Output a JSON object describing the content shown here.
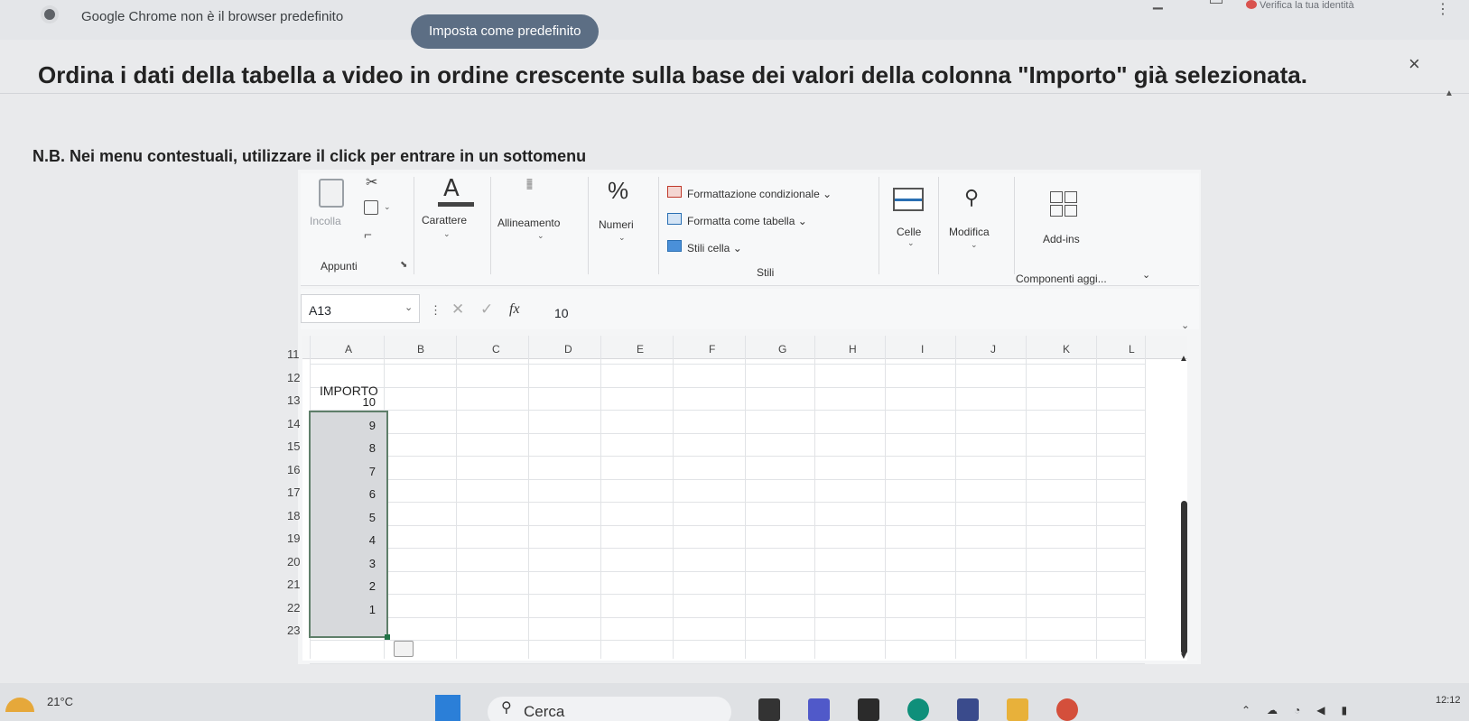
{
  "chrome": {
    "message": "Google Chrome non è il browser predefinito",
    "button": "Imposta come predefinito",
    "identity": "Verifica la tua identità"
  },
  "instructions": {
    "title": "Ordina i dati della tabella a video in ordine crescente sulla base dei valori della colonna \"Importo\" già selezionata.",
    "note": "N.B. Nei menu contestuali, utilizzare il click per entrare in un sottomenu",
    "close": "×"
  },
  "ribbon": {
    "paste": "Incolla",
    "clipboard_group": "Appunti",
    "font": "Carattere",
    "alignment": "Allineamento",
    "number": "Numeri",
    "conditional": "Formattazione condizionale",
    "format_table": "Formatta come tabella",
    "cell_styles": "Stili cella",
    "styles_group": "Stili",
    "cells": "Celle",
    "edit": "Modifica",
    "addins": "Add-ins",
    "addins_group": "Componenti aggi..."
  },
  "formula_bar": {
    "name_box": "A13",
    "fx": "fx",
    "value": "10"
  },
  "grid": {
    "columns": [
      "A",
      "B",
      "C",
      "D",
      "E",
      "F",
      "G",
      "H",
      "I",
      "J",
      "K",
      "L"
    ],
    "rows": [
      "11",
      "12",
      "13",
      "14",
      "15",
      "16",
      "17",
      "18",
      "19",
      "20",
      "21",
      "22",
      "23"
    ],
    "header": "IMPORTO",
    "values": [
      "10",
      "9",
      "8",
      "7",
      "6",
      "5",
      "4",
      "3",
      "2",
      "1"
    ]
  },
  "taskbar": {
    "weather": "21°C",
    "search": "Cerca",
    "clock": "12:12"
  },
  "colors": {
    "accent": "#217346",
    "chrome_button": "#5c6e84",
    "selection": "#d7d9dc"
  }
}
